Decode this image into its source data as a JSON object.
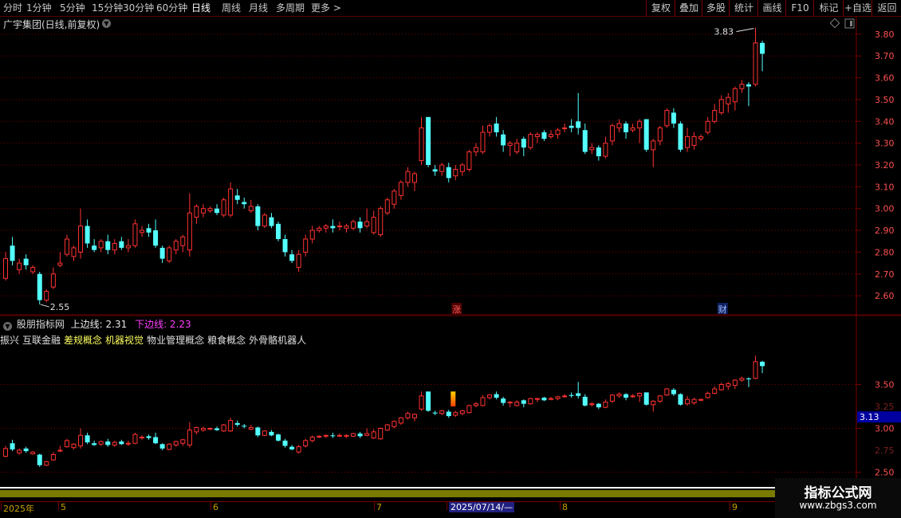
{
  "toolbar": {
    "periods": [
      "分时",
      "1分钟",
      "5分钟",
      "15分钟",
      "30分钟",
      "60分钟",
      "日线",
      "周线",
      "月线",
      "多周期",
      "更多 >"
    ],
    "active_period": "日线",
    "buttons": [
      "复权",
      "叠加",
      "多股",
      "统计",
      "画线",
      "F10",
      "标记",
      "+自选",
      "返回"
    ]
  },
  "main_chart": {
    "title": "广宇集团(日线,前复权)",
    "y_ticks": [
      "3.80",
      "3.70",
      "3.60",
      "3.50",
      "3.40",
      "3.30",
      "3.20",
      "3.10",
      "3.00",
      "2.90",
      "2.80",
      "2.70",
      "2.60"
    ],
    "high_label": "3.83",
    "low_label": "2.55",
    "markers": [
      "涨",
      "财"
    ]
  },
  "indicator": {
    "title": "股朋指标网",
    "upper_label": "上边线: 2.31",
    "lower_label": "下边线: 2.23",
    "y_ticks": [
      "3.50",
      "3.00",
      "2.50"
    ],
    "current_value": "3.13"
  },
  "concepts": [
    {
      "text": "振兴",
      "color": "#e0e0e0"
    },
    {
      "text": "互联金融",
      "color": "#e0e0e0"
    },
    {
      "text": "差规概念",
      "color": "#ffff60"
    },
    {
      "text": "机器视觉",
      "color": "#ffff60"
    },
    {
      "text": "物业管理概念",
      "color": "#e0e0e0"
    },
    {
      "text": "粮食概念",
      "color": "#e0e0e0"
    },
    {
      "text": "外骨骼机器人",
      "color": "#e0e0e0"
    }
  ],
  "date_axis": {
    "labels": [
      "2025年",
      "5",
      "6",
      "7",
      "2025/07/14/—",
      "8",
      "9"
    ],
    "selected": "2025/07/14/—"
  },
  "watermark": {
    "title": "指标公式网",
    "url": "www.zbgs3.com"
  },
  "colors": {
    "up": "#ff3232",
    "down": "#54ffff",
    "grid": "#7a0000",
    "axis_text": "#ff5050",
    "indicator_value_bg": "#0000a0"
  },
  "chart_data": {
    "type": "candlestick",
    "ylim": [
      2.52,
      3.88
    ],
    "series": [
      {
        "name": "日线",
        "ohlc": [
          [
            2.68,
            2.77,
            2.67,
            2.8
          ],
          [
            2.83,
            2.76,
            2.74,
            2.87
          ],
          [
            2.72,
            2.75,
            2.7,
            2.77
          ],
          [
            2.77,
            2.74,
            2.72,
            2.79
          ],
          [
            2.71,
            2.73,
            2.7,
            2.74
          ],
          [
            2.7,
            2.58,
            2.56,
            2.71
          ],
          [
            2.58,
            2.62,
            2.57,
            2.63
          ],
          [
            2.64,
            2.7,
            2.63,
            2.73
          ],
          [
            2.74,
            2.75,
            2.73,
            2.8
          ],
          [
            2.79,
            2.86,
            2.78,
            2.88
          ],
          [
            2.78,
            2.82,
            2.76,
            2.83
          ],
          [
            2.8,
            2.92,
            2.77,
            3.0
          ],
          [
            2.92,
            2.84,
            2.82,
            2.95
          ],
          [
            2.83,
            2.81,
            2.8,
            2.86
          ],
          [
            2.82,
            2.85,
            2.8,
            2.86
          ],
          [
            2.85,
            2.81,
            2.79,
            2.88
          ],
          [
            2.81,
            2.84,
            2.79,
            2.86
          ],
          [
            2.85,
            2.82,
            2.81,
            2.87
          ],
          [
            2.82,
            2.83,
            2.8,
            2.86
          ],
          [
            2.83,
            2.93,
            2.82,
            2.95
          ],
          [
            2.89,
            2.9,
            2.87,
            2.92
          ],
          [
            2.91,
            2.89,
            2.87,
            2.93
          ],
          [
            2.9,
            2.83,
            2.82,
            2.95
          ],
          [
            2.82,
            2.77,
            2.75,
            2.83
          ],
          [
            2.76,
            2.82,
            2.75,
            2.83
          ],
          [
            2.81,
            2.85,
            2.79,
            2.86
          ],
          [
            2.83,
            2.87,
            2.8,
            2.88
          ],
          [
            2.81,
            2.98,
            2.78,
            3.07
          ],
          [
            2.96,
            3.01,
            2.93,
            3.02
          ],
          [
            2.98,
            3.0,
            2.96,
            3.02
          ],
          [
            2.99,
            3.0,
            2.98,
            3.01
          ],
          [
            3.0,
            2.98,
            2.97,
            3.02
          ],
          [
            2.97,
            3.04,
            2.96,
            3.05
          ],
          [
            2.97,
            3.09,
            2.96,
            3.12
          ],
          [
            3.06,
            3.04,
            3.02,
            3.09
          ],
          [
            3.03,
            3.02,
            3.0,
            3.05
          ],
          [
            2.99,
            3.01,
            2.98,
            3.04
          ],
          [
            3.01,
            2.92,
            2.9,
            3.02
          ],
          [
            2.92,
            2.97,
            2.91,
            2.98
          ],
          [
            2.96,
            2.92,
            2.91,
            2.98
          ],
          [
            2.93,
            2.86,
            2.85,
            2.94
          ],
          [
            2.86,
            2.8,
            2.78,
            2.88
          ],
          [
            2.79,
            2.76,
            2.75,
            2.81
          ],
          [
            2.73,
            2.79,
            2.71,
            2.81
          ],
          [
            2.8,
            2.86,
            2.78,
            2.88
          ],
          [
            2.86,
            2.9,
            2.84,
            2.92
          ],
          [
            2.9,
            2.91,
            2.89,
            2.92
          ],
          [
            2.91,
            2.92,
            2.89,
            2.93
          ],
          [
            2.92,
            2.91,
            2.89,
            2.95
          ],
          [
            2.92,
            2.92,
            2.9,
            2.94
          ],
          [
            2.91,
            2.92,
            2.89,
            2.93
          ],
          [
            2.91,
            2.94,
            2.9,
            2.95
          ],
          [
            2.94,
            2.91,
            2.89,
            2.96
          ],
          [
            2.92,
            2.94,
            2.91,
            3.0
          ],
          [
            2.89,
            2.96,
            2.88,
            2.99
          ],
          [
            2.88,
            3.0,
            2.87,
            3.01
          ],
          [
            2.98,
            3.04,
            2.97,
            3.05
          ],
          [
            3.02,
            3.08,
            3.0,
            3.09
          ],
          [
            3.06,
            3.12,
            3.04,
            3.13
          ],
          [
            3.12,
            3.17,
            3.1,
            3.19
          ],
          [
            3.12,
            3.16,
            3.08,
            3.17
          ],
          [
            3.22,
            3.37,
            3.2,
            3.42
          ],
          [
            3.42,
            3.2,
            3.19,
            3.42
          ],
          [
            3.18,
            3.17,
            3.15,
            3.2
          ],
          [
            3.17,
            3.2,
            3.15,
            3.21
          ],
          [
            3.19,
            3.14,
            3.12,
            3.21
          ],
          [
            3.15,
            3.18,
            3.13,
            3.2
          ],
          [
            3.17,
            3.2,
            3.15,
            3.21
          ],
          [
            3.18,
            3.26,
            3.17,
            3.27
          ],
          [
            3.26,
            3.28,
            3.24,
            3.3
          ],
          [
            3.26,
            3.35,
            3.25,
            3.38
          ],
          [
            3.35,
            3.38,
            3.33,
            3.39
          ],
          [
            3.39,
            3.35,
            3.33,
            3.42
          ],
          [
            3.34,
            3.29,
            3.26,
            3.36
          ],
          [
            3.29,
            3.3,
            3.24,
            3.31
          ],
          [
            3.26,
            3.3,
            3.25,
            3.32
          ],
          [
            3.32,
            3.28,
            3.24,
            3.33
          ],
          [
            3.28,
            3.34,
            3.27,
            3.35
          ],
          [
            3.33,
            3.34,
            3.3,
            3.35
          ],
          [
            3.35,
            3.32,
            3.31,
            3.36
          ],
          [
            3.33,
            3.34,
            3.32,
            3.36
          ],
          [
            3.34,
            3.36,
            3.32,
            3.37
          ],
          [
            3.37,
            3.37,
            3.35,
            3.39
          ],
          [
            3.38,
            3.37,
            3.35,
            3.41
          ],
          [
            3.4,
            3.37,
            3.34,
            3.53
          ],
          [
            3.36,
            3.26,
            3.25,
            3.39
          ],
          [
            3.27,
            3.28,
            3.25,
            3.3
          ],
          [
            3.28,
            3.24,
            3.22,
            3.29
          ],
          [
            3.24,
            3.3,
            3.23,
            3.33
          ],
          [
            3.31,
            3.38,
            3.29,
            3.39
          ],
          [
            3.37,
            3.39,
            3.35,
            3.41
          ],
          [
            3.39,
            3.35,
            3.32,
            3.4
          ],
          [
            3.36,
            3.37,
            3.35,
            3.39
          ],
          [
            3.37,
            3.4,
            3.3,
            3.41
          ],
          [
            3.41,
            3.27,
            3.26,
            3.41
          ],
          [
            3.27,
            3.31,
            3.19,
            3.32
          ],
          [
            3.31,
            3.37,
            3.29,
            3.38
          ],
          [
            3.38,
            3.45,
            3.37,
            3.46
          ],
          [
            3.44,
            3.39,
            3.37,
            3.46
          ],
          [
            3.39,
            3.27,
            3.26,
            3.4
          ],
          [
            3.28,
            3.33,
            3.26,
            3.37
          ],
          [
            3.29,
            3.33,
            3.27,
            3.35
          ],
          [
            3.32,
            3.33,
            3.31,
            3.34
          ],
          [
            3.35,
            3.4,
            3.34,
            3.42
          ],
          [
            3.4,
            3.45,
            3.39,
            3.48
          ],
          [
            3.44,
            3.5,
            3.43,
            3.52
          ],
          [
            3.48,
            3.51,
            3.44,
            3.53
          ],
          [
            3.49,
            3.55,
            3.45,
            3.56
          ],
          [
            3.55,
            3.57,
            3.53,
            3.59
          ],
          [
            3.57,
            3.56,
            3.47,
            3.58
          ],
          [
            3.57,
            3.76,
            3.56,
            3.83
          ],
          [
            3.76,
            3.71,
            3.63,
            3.77
          ]
        ]
      }
    ]
  }
}
